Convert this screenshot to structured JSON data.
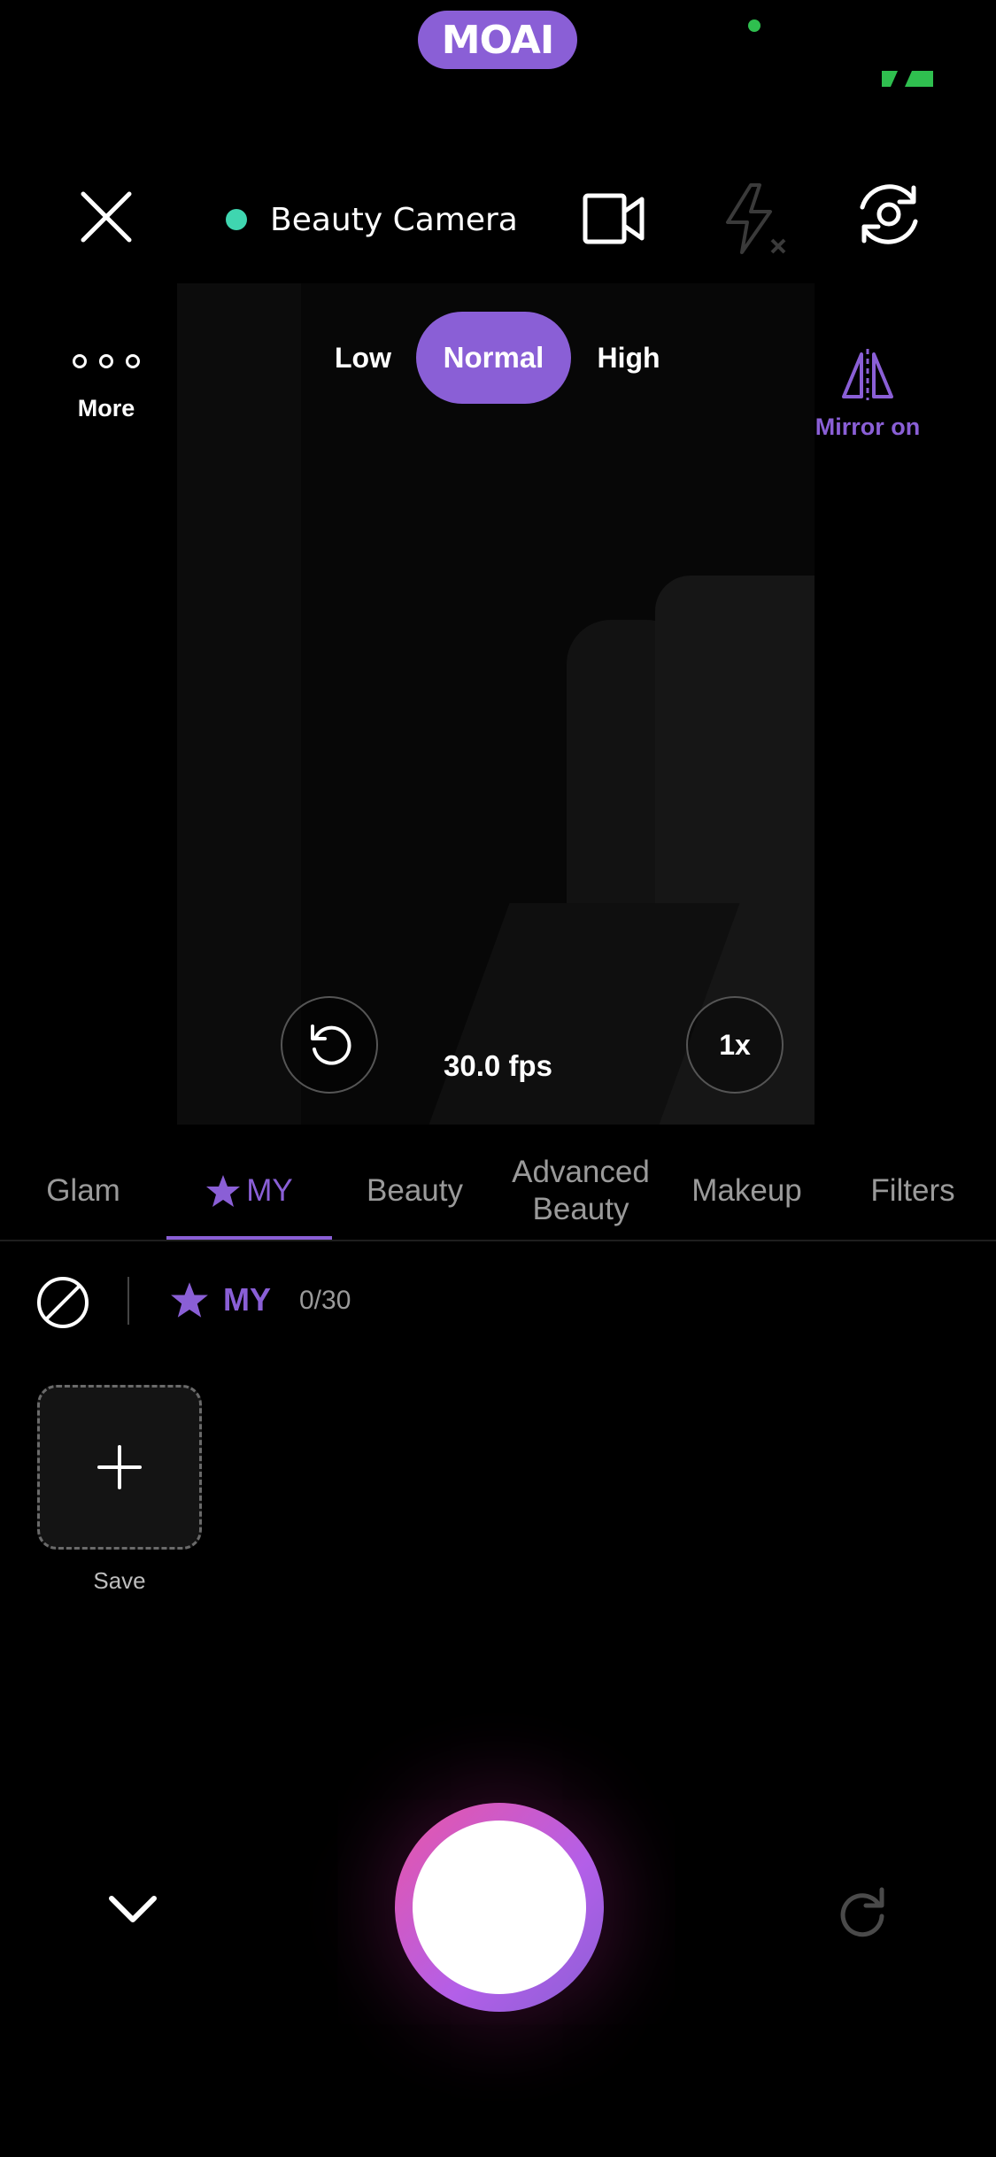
{
  "status": {
    "app_badge": "MOAI",
    "colors": {
      "badge": "#8a5fd6",
      "indicator_dot": "#2fbf4f",
      "battery": "#2fbf4f"
    }
  },
  "topbar": {
    "close_icon": "close-icon",
    "camera_mode_label": "Beauty Camera",
    "camera_dot_color": "#3fd6b0",
    "video_icon": "video-camera-icon",
    "flash_icon": "flash-off-icon",
    "switch_icon": "switch-camera-icon"
  },
  "intensity": {
    "options": [
      "Low",
      "Normal",
      "High"
    ],
    "selected": "Normal"
  },
  "side": {
    "more_label": "More",
    "mirror_label": "Mirror on"
  },
  "preview": {
    "fps": "30.0 fps",
    "zoom": "1x"
  },
  "tabs": {
    "items": [
      "Glam",
      "MY",
      "Beauty",
      "Advanced Beauty",
      "Makeup",
      "Filters"
    ],
    "active": "MY",
    "glam": "Glam",
    "my": "MY",
    "beauty": "Beauty",
    "advanced_line1": "Advanced",
    "advanced_line2": "Beauty",
    "makeup": "Makeup",
    "filters": "Filters"
  },
  "my_section": {
    "label": "MY",
    "count": "0/30",
    "save_label": "Save"
  },
  "accent_color": "#8a5fd6"
}
